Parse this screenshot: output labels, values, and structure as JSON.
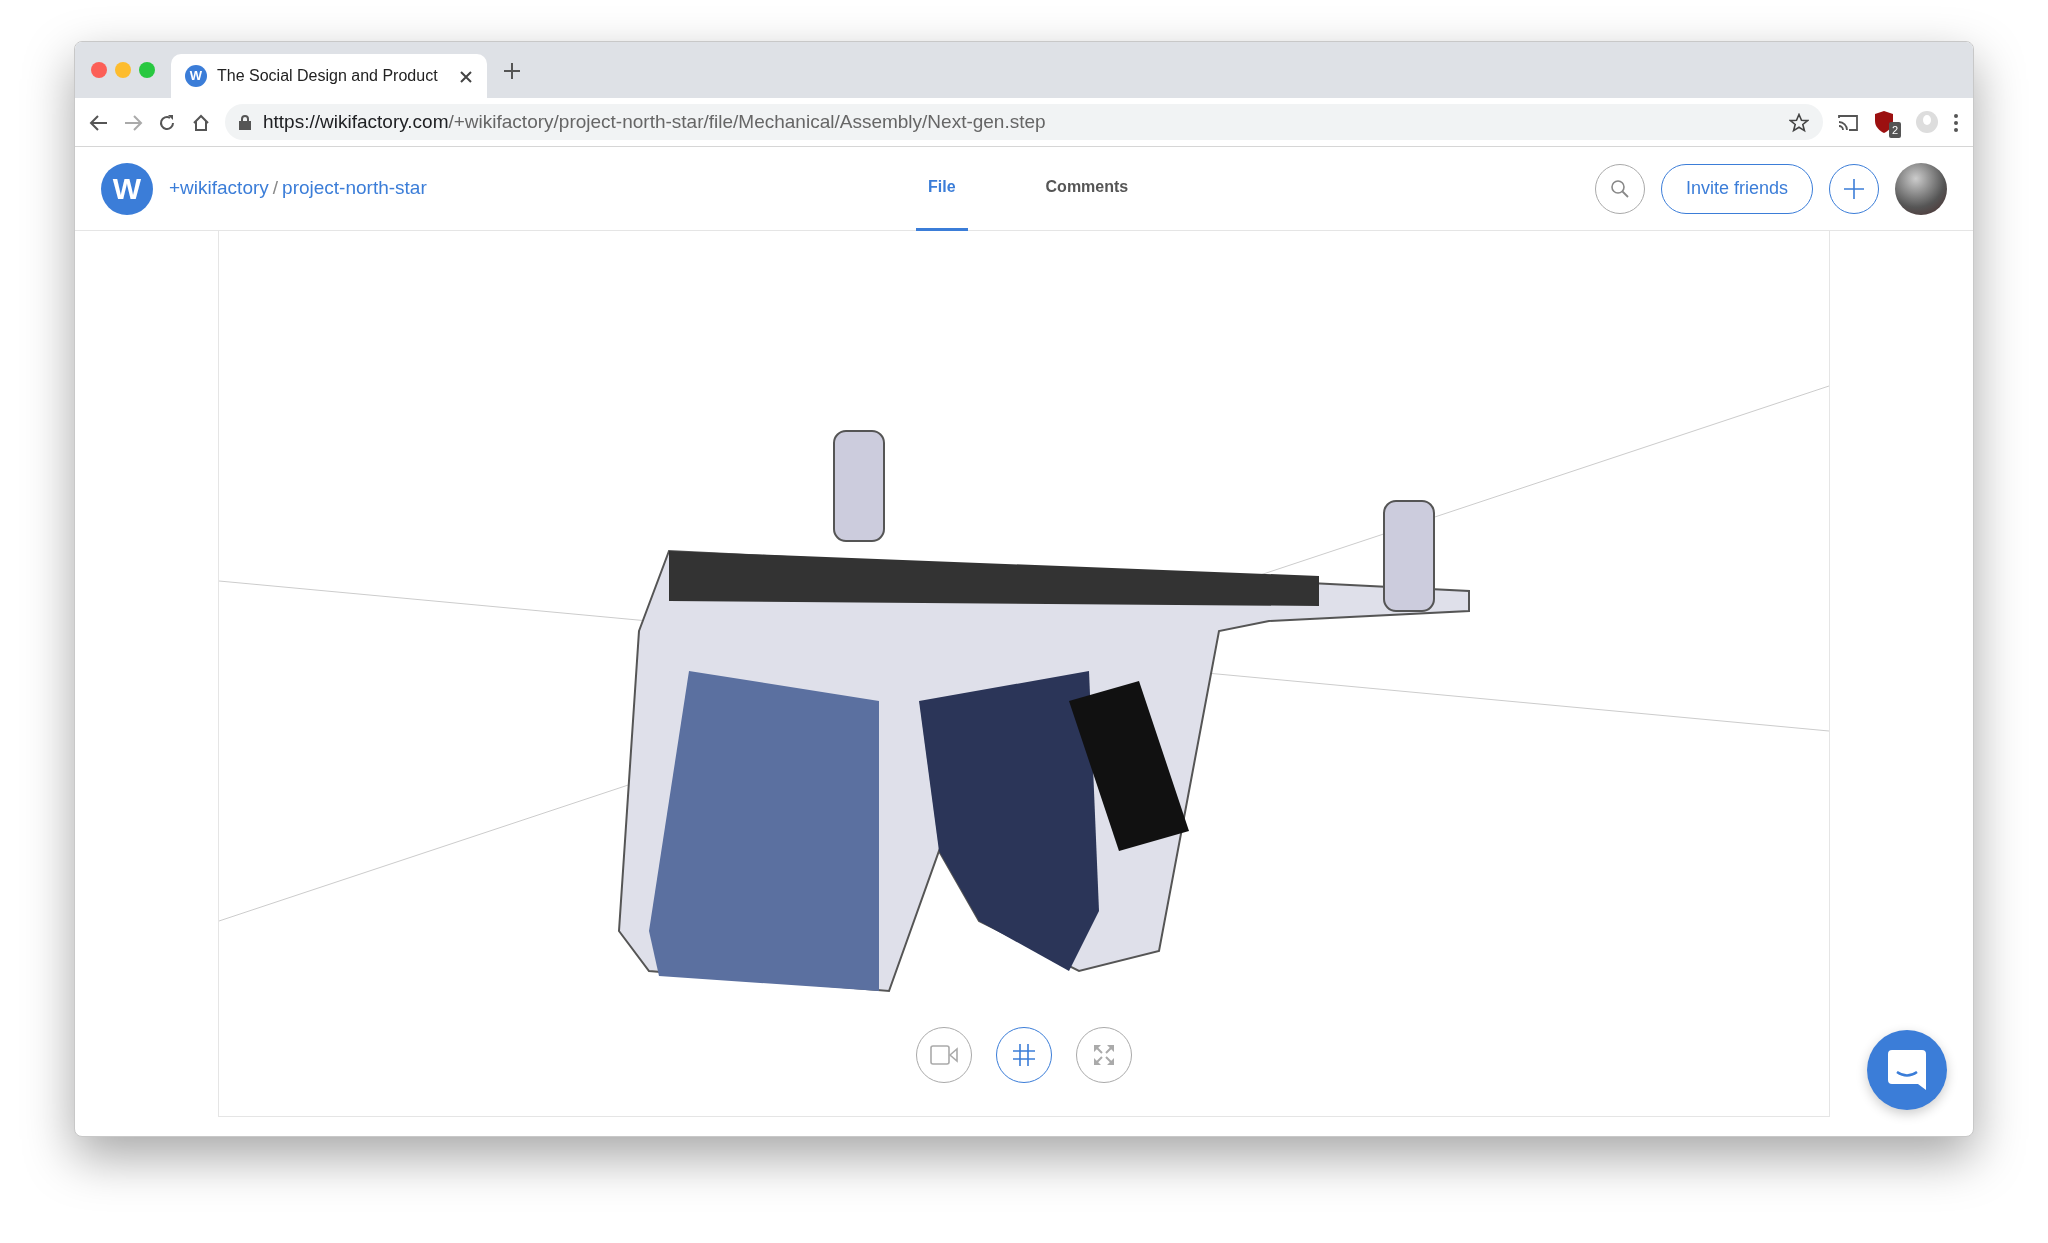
{
  "browser": {
    "tab": {
      "favicon": "W",
      "title": "The Social Design and Product",
      "selected": true
    },
    "url": {
      "host": "https://wikifactory.com",
      "path": "/+wikifactory/project-north-star/file/Mechanical/Assembly/Next-gen.step"
    },
    "extension_badge": "2"
  },
  "header": {
    "logo": "W",
    "breadcrumb": [
      {
        "text": "+wikifactory"
      },
      {
        "text": "project-north-star"
      }
    ],
    "separator": "/",
    "tabs": [
      {
        "label": "File",
        "selected": true
      },
      {
        "label": "Comments",
        "selected": false
      }
    ],
    "invite_button": "Invite friends"
  },
  "viewer": {
    "controls": [
      {
        "kind": "camera",
        "selected": false
      },
      {
        "kind": "grid",
        "selected": true
      },
      {
        "kind": "fullscreen",
        "selected": false
      }
    ]
  }
}
